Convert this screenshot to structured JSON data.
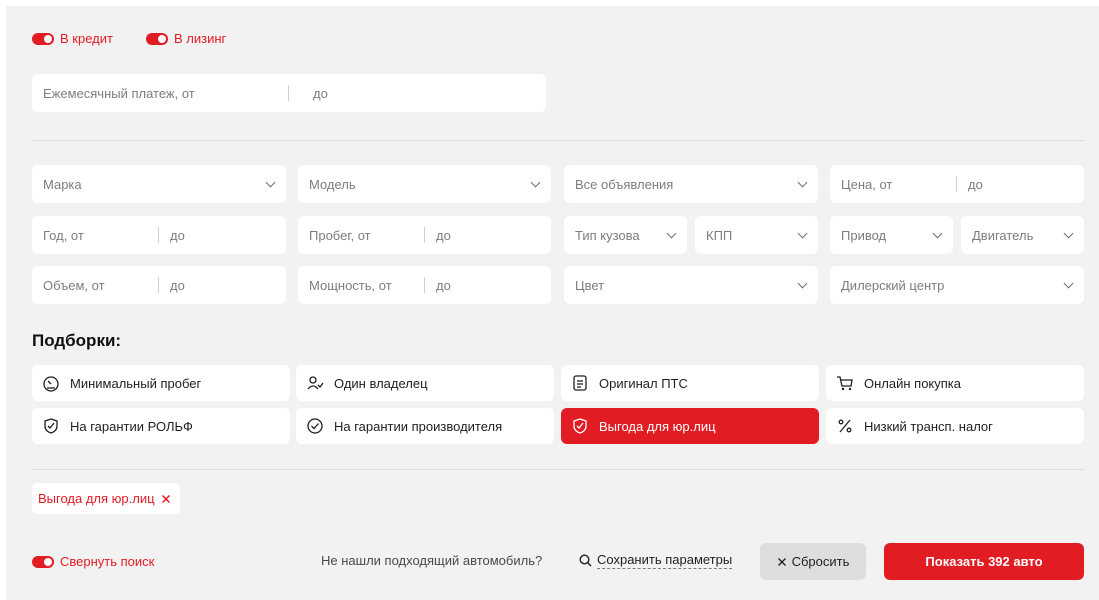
{
  "toggles": {
    "credit": "В кредит",
    "leasing": "В лизинг",
    "collapse": "Свернуть поиск"
  },
  "payment": {
    "from": "Ежемесячный платеж, от",
    "to": "до"
  },
  "filters": {
    "brand": "Марка",
    "model": "Модель",
    "all_ads": "Все объявления",
    "price_from": "Цена, от",
    "price_to": "до",
    "year_from": "Год, от",
    "year_to": "до",
    "mileage_from": "Пробег, от",
    "mileage_to": "до",
    "body_type": "Тип кузова",
    "gearbox": "КПП",
    "drive": "Привод",
    "engine": "Двигатель",
    "volume_from": "Объем, от",
    "volume_to": "до",
    "power_from": "Мощность, от",
    "power_to": "до",
    "color": "Цвет",
    "dealer": "Дилерский центр"
  },
  "collections": {
    "heading": "Подборки:",
    "items": [
      {
        "label": "Минимальный пробег",
        "icon": "speedometer-icon"
      },
      {
        "label": "Один владелец",
        "icon": "person-check-icon"
      },
      {
        "label": "Оригинал ПТС",
        "icon": "document-icon"
      },
      {
        "label": "Онлайн покупка",
        "icon": "cart-icon"
      },
      {
        "label": "На гарантии РОЛЬФ",
        "icon": "shield-check-icon"
      },
      {
        "label": "На гарантии производителя",
        "icon": "circle-check-icon"
      },
      {
        "label": "Выгода для юр.лиц",
        "icon": "shield-check-icon",
        "active": true
      },
      {
        "label": "Низкий трансп. налог",
        "icon": "percent-icon"
      }
    ]
  },
  "active_tag": "Выгода для юр.лиц",
  "footer": {
    "not_found": "Не нашли подходящий автомобиль?",
    "save": "Сохранить параметры",
    "reset": "Сбросить",
    "show": "Показать 392 авто"
  },
  "colors": {
    "accent": "#e21c23",
    "panel": "#f2f2f3"
  }
}
